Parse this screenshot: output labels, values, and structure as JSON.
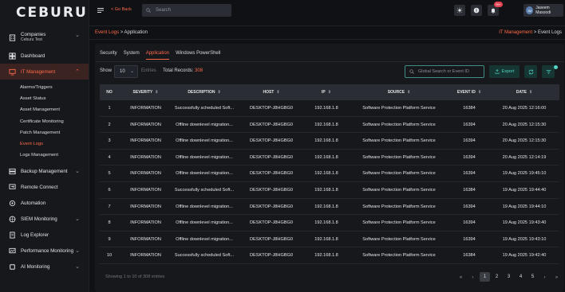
{
  "app": {
    "logo": "CEBURU"
  },
  "sidebar": {
    "company": {
      "label": "Companies",
      "sub": "Ceburu Test"
    },
    "items": [
      {
        "label": "Dashboard",
        "icon": "dashboard-icon"
      },
      {
        "label": "IT Management",
        "icon": "it-management-icon"
      },
      {
        "label": "Backup Management",
        "icon": "backup-icon"
      },
      {
        "label": "Remote Connect",
        "icon": "remote-connect-icon"
      },
      {
        "label": "Automation",
        "icon": "automation-icon"
      },
      {
        "label": "SIEM Monitoring",
        "icon": "siem-icon"
      },
      {
        "label": "Log Explorer",
        "icon": "log-explorer-icon"
      },
      {
        "label": "Performance Monitoring",
        "icon": "performance-icon"
      },
      {
        "label": "AI Monitoring",
        "icon": "ai-icon"
      }
    ],
    "subitems": [
      "Alarms/Triggers",
      "Asset Status",
      "Asset Management",
      "Certificate Monitoring",
      "Patch Management",
      "Event Logs",
      "Logs Management"
    ]
  },
  "topbar": {
    "go_back": "< Go Back",
    "search_placeholder": "Search",
    "notification_count": "99+",
    "user_name": "Jaseem Masoodi",
    "user_initials": "JM"
  },
  "breadcrumb": {
    "left_parent": "Event Logs",
    "left_sep": " > ",
    "left_current": "Application",
    "right_parent": "IT Management",
    "right_sep": " > ",
    "right_current": "Event Logs"
  },
  "tabs": [
    "Security",
    "System",
    "Application",
    "Windows PowerShell"
  ],
  "controls": {
    "show_label": "Show",
    "show_value": "10",
    "entries_label": "Entries",
    "records_label": "Total Records:",
    "records_value": "308",
    "global_search_placeholder": "Global Search or Event ID",
    "export_label": "Export"
  },
  "table": {
    "columns": [
      "NO",
      "SEVERITY",
      "DESCRIPTION",
      "HOST",
      "IP",
      "SOURCE",
      "EVENT ID",
      "DATE"
    ],
    "rows": [
      [
        "1",
        "INFORMATION",
        "Successfully scheduled Soft...",
        "DESKTOP-J8HGBG0",
        "192.168.1.8",
        "Software Protection Platform Service",
        "16384",
        "20 Aug 2025 12:16:00"
      ],
      [
        "2",
        "INFORMATION",
        "Offline downlevel migration...",
        "DESKTOP-J8HGBG0",
        "192.168.1.8",
        "Software Protection Platform Service",
        "16394",
        "20 Aug 2025 12:15:30"
      ],
      [
        "3",
        "INFORMATION",
        "Offline downlevel migration...",
        "DESKTOP-J8HGBG0",
        "192.168.1.8",
        "Software Protection Platform Service",
        "16394",
        "20 Aug 2025 12:15:30"
      ],
      [
        "4",
        "INFORMATION",
        "Offline downlevel migration...",
        "DESKTOP-J8HGBG0",
        "192.168.1.8",
        "Software Protection Platform Service",
        "16394",
        "20 Aug 2025 12:14:19"
      ],
      [
        "5",
        "INFORMATION",
        "Offline downlevel migration...",
        "DESKTOP-J8HGBG0",
        "192.168.1.8",
        "Software Protection Platform Service",
        "16394",
        "19 Aug 2025 19:45:10"
      ],
      [
        "6",
        "INFORMATION",
        "Successfully scheduled Soft...",
        "DESKTOP-J8HGBG0",
        "192.168.1.8",
        "Software Protection Platform Service",
        "16384",
        "19 Aug 2025 19:44:40"
      ],
      [
        "7",
        "INFORMATION",
        "Offline downlevel migration...",
        "DESKTOP-J8HGBG0",
        "192.168.1.8",
        "Software Protection Platform Service",
        "16394",
        "19 Aug 2025 19:44:10"
      ],
      [
        "8",
        "INFORMATION",
        "Offline downlevel migration...",
        "DESKTOP-J8HGBG0",
        "192.168.1.8",
        "Software Protection Platform Service",
        "16394",
        "19 Aug 2025 19:43:40"
      ],
      [
        "9",
        "INFORMATION",
        "Offline downlevel migration...",
        "DESKTOP-J8HGBG0",
        "192.168.1.8",
        "Software Protection Platform Service",
        "16394",
        "19 Aug 2025 19:43:10"
      ],
      [
        "10",
        "INFORMATION",
        "Successfully scheduled Soft...",
        "DESKTOP-J8HGBG0",
        "192.168.1.8",
        "Software Protection Platform Service",
        "16384",
        "19 Aug 2025 19:42:40"
      ]
    ]
  },
  "footer": {
    "showing": "Showing 1 to 10 of 308 entries",
    "pages": [
      "1",
      "2",
      "3",
      "4",
      "5"
    ],
    "first": "«",
    "prev": "‹",
    "next": "›",
    "last": "»"
  },
  "colors": {
    "accent": "#ff6a4a",
    "teal": "#54d4c3"
  }
}
